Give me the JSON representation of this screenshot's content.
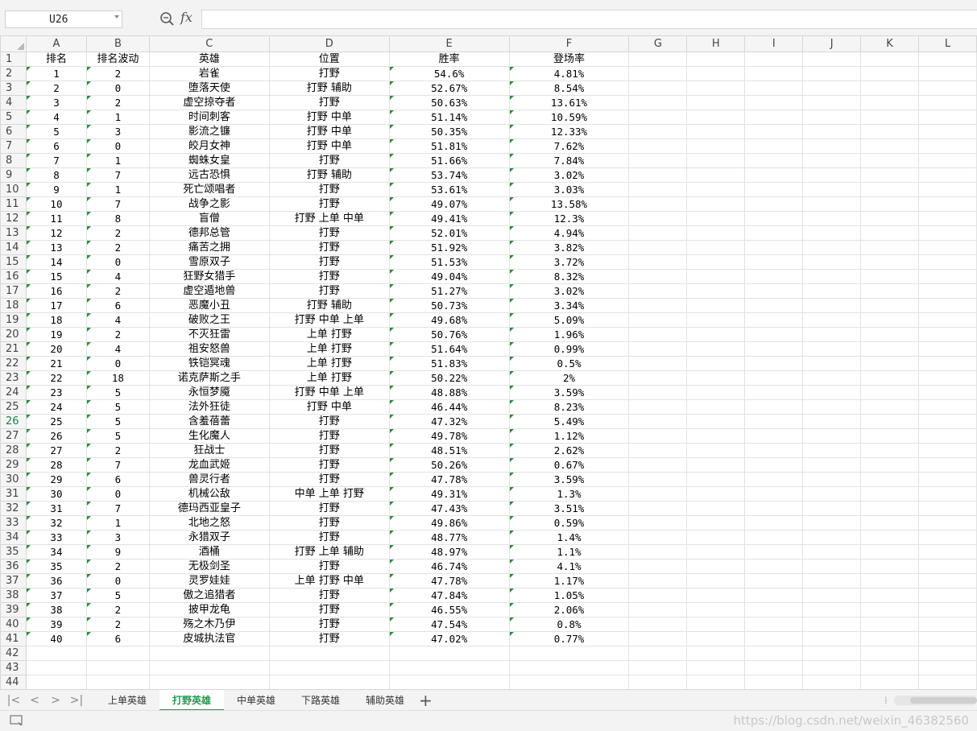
{
  "formula_bar": {
    "name_box": "U26",
    "fx": "fx",
    "formula": ""
  },
  "columns": [
    "A",
    "B",
    "C",
    "D",
    "E",
    "F",
    "G",
    "H",
    "I",
    "J",
    "K",
    "L"
  ],
  "row_numbers": [
    1,
    2,
    3,
    4,
    5,
    6,
    7,
    8,
    9,
    10,
    11,
    12,
    13,
    14,
    15,
    16,
    17,
    18,
    19,
    20,
    21,
    22,
    23,
    24,
    25,
    26,
    27,
    28,
    29,
    30,
    31,
    32,
    33,
    34,
    35,
    36,
    37,
    38,
    39,
    40,
    41,
    42,
    43,
    44
  ],
  "active_row": 26,
  "header_row": [
    "排名",
    "排名波动",
    "英雄",
    "位置",
    "胜率",
    "登场率"
  ],
  "rows": [
    [
      "1",
      "2",
      "岩雀",
      "打野",
      "54.6%",
      "4.81%"
    ],
    [
      "2",
      "0",
      "堕落天使",
      "打野 辅助",
      "52.67%",
      "8.54%"
    ],
    [
      "3",
      "2",
      "虚空掠夺者",
      "打野",
      "50.63%",
      "13.61%"
    ],
    [
      "4",
      "1",
      "时间刺客",
      "打野 中单",
      "51.14%",
      "10.59%"
    ],
    [
      "5",
      "3",
      "影流之镰",
      "打野 中单",
      "50.35%",
      "12.33%"
    ],
    [
      "6",
      "0",
      "皎月女神",
      "打野 中单",
      "51.81%",
      "7.62%"
    ],
    [
      "7",
      "1",
      "蜘蛛女皇",
      "打野",
      "51.66%",
      "7.84%"
    ],
    [
      "8",
      "7",
      "远古恐惧",
      "打野 辅助",
      "53.74%",
      "3.02%"
    ],
    [
      "9",
      "1",
      "死亡颂唱者",
      "打野",
      "53.61%",
      "3.03%"
    ],
    [
      "10",
      "7",
      "战争之影",
      "打野",
      "49.07%",
      "13.58%"
    ],
    [
      "11",
      "8",
      "盲僧",
      "打野 上单 中单",
      "49.41%",
      "12.3%"
    ],
    [
      "12",
      "2",
      "德邦总管",
      "打野",
      "52.01%",
      "4.94%"
    ],
    [
      "13",
      "2",
      "痛苦之拥",
      "打野",
      "51.92%",
      "3.82%"
    ],
    [
      "14",
      "0",
      "雪原双子",
      "打野",
      "51.53%",
      "3.72%"
    ],
    [
      "15",
      "4",
      "狂野女猎手",
      "打野",
      "49.04%",
      "8.32%"
    ],
    [
      "16",
      "2",
      "虚空遁地兽",
      "打野",
      "51.27%",
      "3.02%"
    ],
    [
      "17",
      "6",
      "恶魔小丑",
      "打野 辅助",
      "50.73%",
      "3.34%"
    ],
    [
      "18",
      "4",
      "破败之王",
      "打野 中单 上单",
      "49.68%",
      "5.09%"
    ],
    [
      "19",
      "2",
      "不灭狂雷",
      "上单 打野",
      "50.76%",
      "1.96%"
    ],
    [
      "20",
      "4",
      "祖安怒兽",
      "上单 打野",
      "51.64%",
      "0.99%"
    ],
    [
      "21",
      "0",
      "铁铠冥魂",
      "上单 打野",
      "51.83%",
      "0.5%"
    ],
    [
      "22",
      "18",
      "诺克萨斯之手",
      "上单 打野",
      "50.22%",
      "2%"
    ],
    [
      "23",
      "5",
      "永恒梦魇",
      "打野 中单 上单",
      "48.88%",
      "3.59%"
    ],
    [
      "24",
      "5",
      "法外狂徒",
      "打野 中单",
      "46.44%",
      "8.23%"
    ],
    [
      "25",
      "5",
      "含羞蓓蕾",
      "打野",
      "47.32%",
      "5.49%"
    ],
    [
      "26",
      "5",
      "生化魔人",
      "打野",
      "49.78%",
      "1.12%"
    ],
    [
      "27",
      "2",
      "狂战士",
      "打野",
      "48.51%",
      "2.62%"
    ],
    [
      "28",
      "7",
      "龙血武姬",
      "打野",
      "50.26%",
      "0.67%"
    ],
    [
      "29",
      "6",
      "兽灵行者",
      "打野",
      "47.78%",
      "3.59%"
    ],
    [
      "30",
      "0",
      "机械公敌",
      "中单 上单 打野",
      "49.31%",
      "1.3%"
    ],
    [
      "31",
      "7",
      "德玛西亚皇子",
      "打野",
      "47.43%",
      "3.51%"
    ],
    [
      "32",
      "1",
      "北地之怒",
      "打野",
      "49.86%",
      "0.59%"
    ],
    [
      "33",
      "3",
      "永猎双子",
      "打野",
      "48.77%",
      "1.4%"
    ],
    [
      "34",
      "9",
      "酒桶",
      "打野 上单 辅助",
      "48.97%",
      "1.1%"
    ],
    [
      "35",
      "2",
      "无极剑圣",
      "打野",
      "46.74%",
      "4.1%"
    ],
    [
      "36",
      "0",
      "灵罗娃娃",
      "上单 打野 中单",
      "47.78%",
      "1.17%"
    ],
    [
      "37",
      "5",
      "傲之追猎者",
      "打野",
      "47.84%",
      "1.05%"
    ],
    [
      "38",
      "2",
      "披甲龙龟",
      "打野",
      "46.55%",
      "2.06%"
    ],
    [
      "39",
      "2",
      "殇之木乃伊",
      "打野",
      "47.54%",
      "0.8%"
    ],
    [
      "40",
      "6",
      "皮城执法官",
      "打野",
      "47.02%",
      "0.77%"
    ]
  ],
  "sheet_tabs": [
    "上单英雄",
    "打野英雄",
    "中单英雄",
    "下路英雄",
    "辅助英雄"
  ],
  "active_sheet": "打野英雄",
  "add_sheet": "+",
  "watermark": "https://blog.csdn.net/weixin_46382560",
  "icons": [
    "zoom-icon",
    "first-sheet-icon",
    "prev-sheet-icon",
    "next-sheet-icon",
    "last-sheet-icon",
    "add-sheet-icon",
    "status-icon"
  ]
}
